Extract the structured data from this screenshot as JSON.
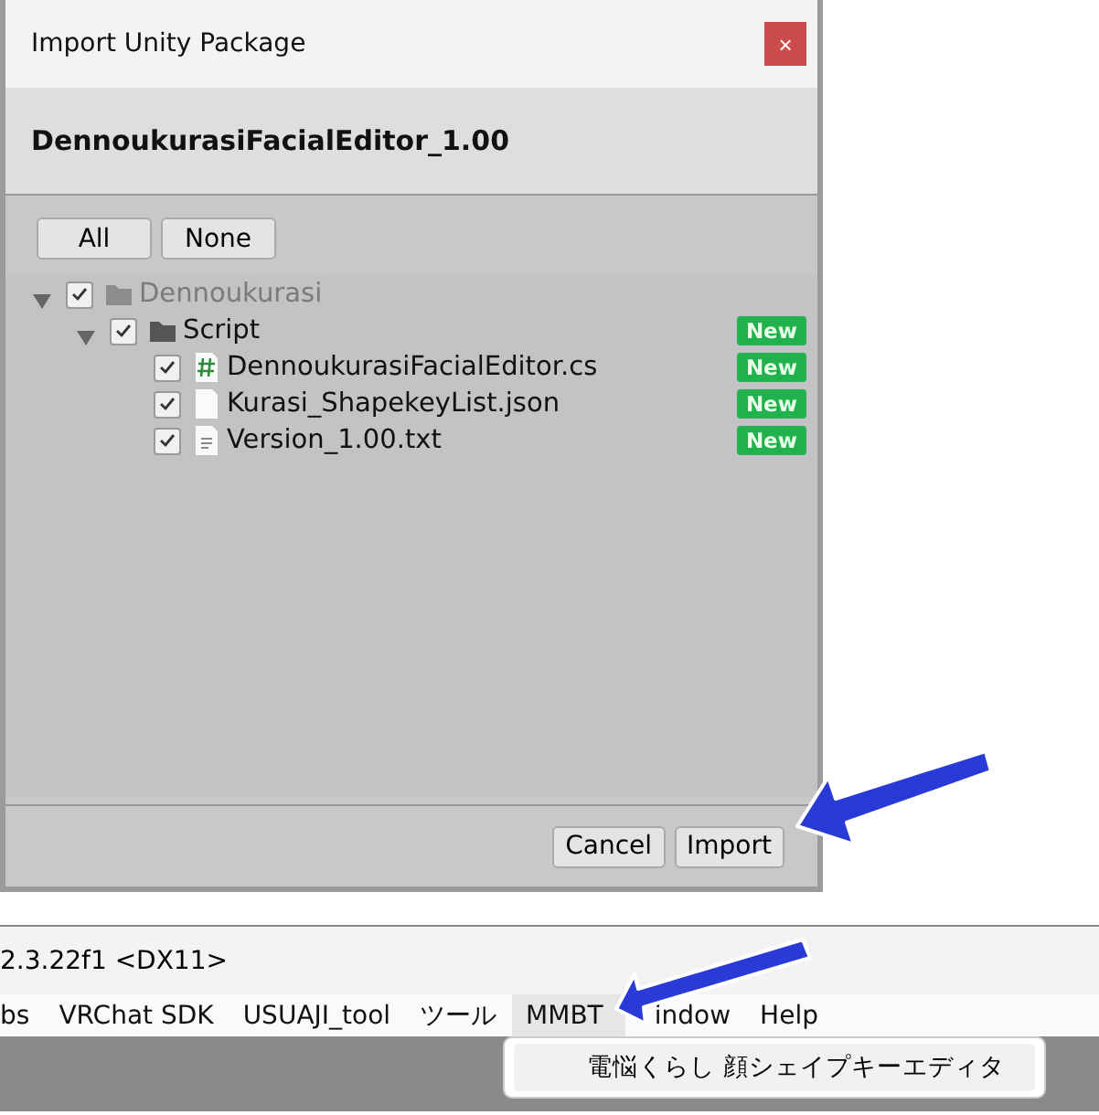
{
  "dialog": {
    "title": "Import Unity Package",
    "close": "×",
    "package_name": "DennoukurasiFacialEditor_1.00",
    "select_buttons": [
      "All",
      "None"
    ],
    "tree": [
      {
        "name": "Dennoukurasi",
        "kind": "folder",
        "checked": true,
        "expanded": true,
        "disabled": true,
        "children": [
          {
            "name": "Script",
            "kind": "folder",
            "checked": true,
            "expanded": true,
            "disabled": false,
            "badge": "New",
            "children": [
              {
                "name": "DennoukurasiFacialEditor.cs",
                "kind": "script",
                "checked": true,
                "disabled": false,
                "badge": "New"
              },
              {
                "name": "Kurasi_ShapekeyList.json",
                "kind": "file",
                "checked": true,
                "disabled": false,
                "badge": "New"
              },
              {
                "name": "Version_1.00.txt",
                "kind": "text",
                "checked": true,
                "disabled": false,
                "badge": "New"
              }
            ]
          }
        ]
      }
    ],
    "footer_buttons": [
      "Cancel",
      "Import"
    ]
  },
  "editor": {
    "title": "2.3.22f1 <DX11>",
    "menu": [
      {
        "label": "bs",
        "selected": false
      },
      {
        "label": "VRChat SDK",
        "selected": false
      },
      {
        "label": "USUAJI_tool",
        "selected": false
      },
      {
        "label": "ツール",
        "selected": false
      },
      {
        "label": "MMBT",
        "selected": true
      },
      {
        "label": "indow",
        "selected": false
      },
      {
        "label": "Help",
        "selected": false
      }
    ],
    "dropdown": [
      "電悩くらし 顔シェイプキーエディタ"
    ]
  }
}
